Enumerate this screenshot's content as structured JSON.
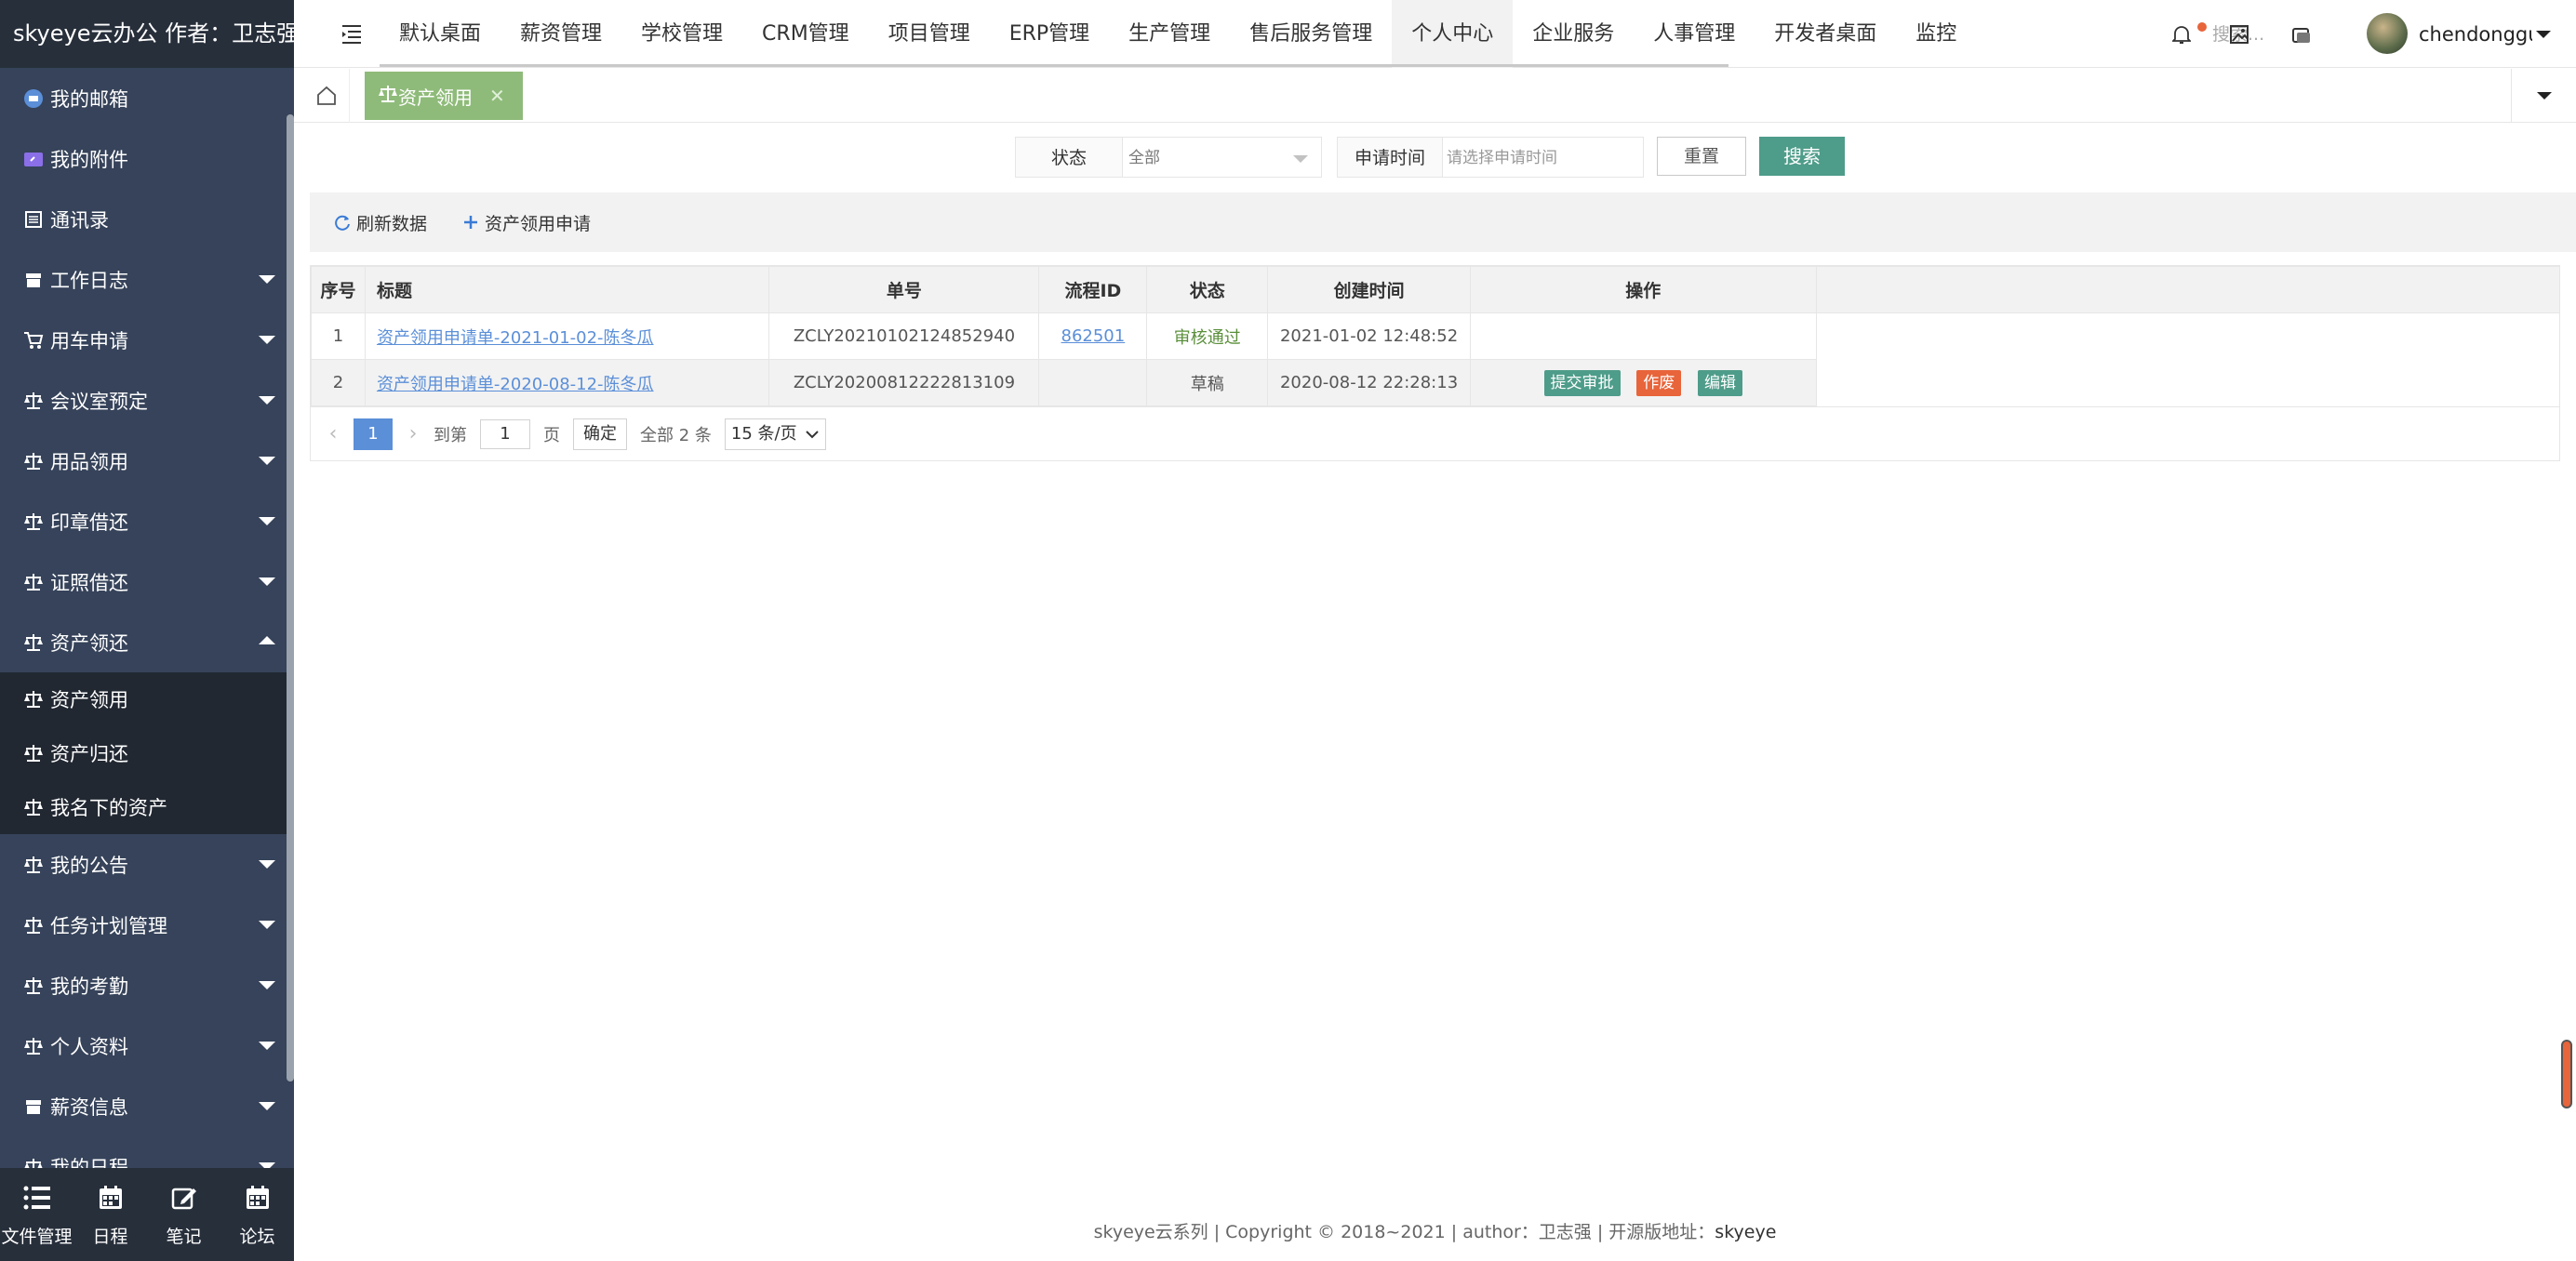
{
  "app": {
    "logo_text": "skyeye云办公 作者：卫志强"
  },
  "sidebar": {
    "items": [
      {
        "label": "我的邮箱"
      },
      {
        "label": "我的附件"
      },
      {
        "label": "通讯录"
      },
      {
        "label": "工作日志"
      },
      {
        "label": "用车申请"
      },
      {
        "label": "会议室预定"
      },
      {
        "label": "用品领用"
      },
      {
        "label": "印章借还"
      },
      {
        "label": "证照借还"
      },
      {
        "label": "资产领还"
      }
    ],
    "sub_items": [
      {
        "label": "资产领用"
      },
      {
        "label": "资产归还"
      },
      {
        "label": "我名下的资产"
      }
    ],
    "items_after": [
      {
        "label": "我的公告"
      },
      {
        "label": "任务计划管理"
      },
      {
        "label": "我的考勤"
      },
      {
        "label": "个人资料"
      },
      {
        "label": "薪资信息"
      },
      {
        "label": "我的日程"
      }
    ],
    "bottom": [
      {
        "label": "文件管理",
        "icon": "list-icon"
      },
      {
        "label": "日程",
        "icon": "calendar-icon"
      },
      {
        "label": "笔记",
        "icon": "edit-icon"
      },
      {
        "label": "论坛",
        "icon": "calendar-icon"
      }
    ]
  },
  "topbar": {
    "menu": [
      {
        "label": "默认桌面"
      },
      {
        "label": "薪资管理"
      },
      {
        "label": "学校管理"
      },
      {
        "label": "CRM管理"
      },
      {
        "label": "项目管理"
      },
      {
        "label": "ERP管理"
      },
      {
        "label": "生产管理"
      },
      {
        "label": "售后服务管理"
      },
      {
        "label": "个人中心"
      },
      {
        "label": "企业服务"
      },
      {
        "label": "人事管理"
      },
      {
        "label": "开发者桌面"
      },
      {
        "label": "监控"
      }
    ],
    "search_placeholder": "搜索...",
    "username": "chendonggua"
  },
  "tabs": {
    "active_label": "资产领用",
    "close_glyph": "✕"
  },
  "filter": {
    "status_label": "状态",
    "status_value": "全部",
    "date_label": "申请时间",
    "date_placeholder": "请选择申请时间",
    "reset_label": "重置",
    "search_label": "搜索"
  },
  "toolbar": {
    "refresh_label": "刷新数据",
    "add_label": "资产领用申请"
  },
  "table": {
    "headers": [
      "序号",
      "标题",
      "单号",
      "流程ID",
      "状态",
      "创建时间",
      "操作"
    ],
    "rows": [
      {
        "index": "1",
        "title": "资产领用申请单-2021-01-02-陈冬瓜",
        "number": "ZCLY20210102124852940",
        "process_id": "862501",
        "status": "审核通过",
        "created": "2021-01-02 12:48:52",
        "ops": []
      },
      {
        "index": "2",
        "title": "资产领用申请单-2020-08-12-陈冬瓜",
        "number": "ZCLY20200812222813109",
        "process_id": "",
        "status": "草稿",
        "created": "2020-08-12 22:28:13",
        "ops": [
          "提交审批",
          "作废",
          "编辑"
        ]
      }
    ]
  },
  "pager": {
    "prev": "‹",
    "current_page": "1",
    "next": "›",
    "goto_label": "到第",
    "goto_value": "1",
    "page_unit": "页",
    "confirm_label": "确定",
    "total_label": "全部 2 条",
    "page_size": "15 条/页"
  },
  "footer": {
    "text": "skyeye云系列 | Copyright © 2018~2021 | author：卫志强 | 开源版地址：",
    "source": "skyeye"
  },
  "colors": {
    "sidebar_bg": "#36435a",
    "accent_green": "#4e9c8a",
    "tab_green": "#8fbb7a",
    "danger_orange": "#e8643a",
    "link_blue": "#5b8fd8"
  }
}
